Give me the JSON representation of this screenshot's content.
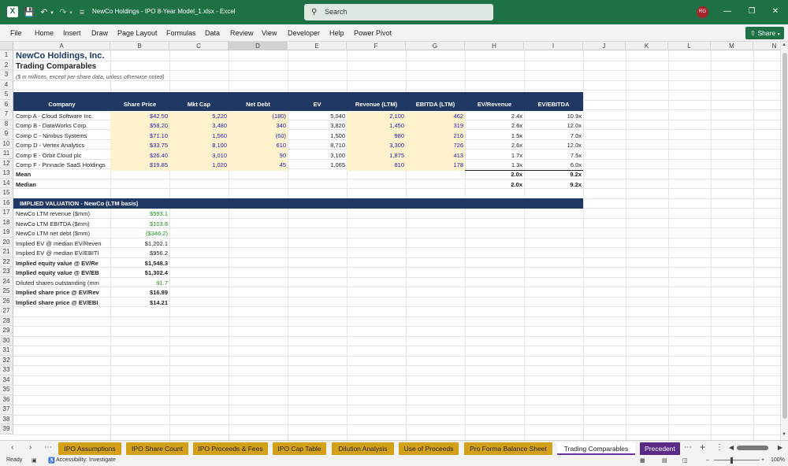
{
  "window": {
    "title": "NewCo Holdings - IPO 8-Year Model_1.xlsx  -  Excel",
    "search_placeholder": "Search",
    "user_initials": "RG",
    "accent": "#1e7145"
  },
  "menu": [
    "File",
    "Home",
    "Insert",
    "Draw",
    "Page Layout",
    "Formulas",
    "Data",
    "Review",
    "View",
    "Developer",
    "Help",
    "Power Pivot"
  ],
  "share_label": "Share",
  "columns": [
    "A",
    "B",
    "C",
    "D",
    "E",
    "F",
    "G",
    "H",
    "I",
    "J",
    "K",
    "L",
    "M",
    "N"
  ],
  "rows": [
    "1",
    "2",
    "3",
    "4",
    "5",
    "6",
    "7",
    "8",
    "9",
    "10",
    "11",
    "12",
    "13",
    "14",
    "15",
    "16",
    "17",
    "18",
    "19",
    "20",
    "21",
    "22",
    "23",
    "24",
    "25",
    "26",
    "27",
    "28",
    "29",
    "30",
    "31",
    "32",
    "33",
    "34",
    "35",
    "36",
    "37",
    "38",
    "39"
  ],
  "sheet": {
    "title": "NewCo Holdings, Inc.",
    "subtitle": "Trading Comparables",
    "note": "($ in millions, except per-share data, unless otherwise noted)",
    "headers": [
      "Company",
      "Share Price",
      "Mkt Cap",
      "Net Debt",
      "EV",
      "Revenue (LTM)",
      "EBITDA (LTM)",
      "EV/Revenue",
      "EV/EBITDA"
    ],
    "comps": [
      {
        "company": "Comp A - Cloud Software Inc.",
        "price": "$42.50",
        "mktcap": "5,220",
        "netdebt": "(180)",
        "ev": "5,040",
        "revenue": "2,100",
        "ebitda": "462",
        "ev_rev": "2.4x",
        "ev_ebitda": "10.9x"
      },
      {
        "company": "Comp B - DataWorks Corp.",
        "price": "$58.20",
        "mktcap": "3,480",
        "netdebt": "340",
        "ev": "3,820",
        "revenue": "1,450",
        "ebitda": "319",
        "ev_rev": "2.6x",
        "ev_ebitda": "12.0x"
      },
      {
        "company": "Comp C - Nimbus Systems",
        "price": "$71.10",
        "mktcap": "1,560",
        "netdebt": "(60)",
        "ev": "1,500",
        "revenue": "980",
        "ebitda": "216",
        "ev_rev": "1.5x",
        "ev_ebitda": "7.0x"
      },
      {
        "company": "Comp D - Vertex Analytics",
        "price": "$33.75",
        "mktcap": "8,100",
        "netdebt": "610",
        "ev": "8,710",
        "revenue": "3,300",
        "ebitda": "726",
        "ev_rev": "2.6x",
        "ev_ebitda": "12.0x"
      },
      {
        "company": "Comp E - Orbit Cloud plc",
        "price": "$26.40",
        "mktcap": "3,010",
        "netdebt": "90",
        "ev": "3,100",
        "revenue": "1,875",
        "ebitda": "413",
        "ev_rev": "1.7x",
        "ev_ebitda": "7.5x"
      },
      {
        "company": "Comp F - Pinnacle SaaS Holdings",
        "price": "$19.85",
        "mktcap": "1,020",
        "netdebt": "45",
        "ev": "1,065",
        "revenue": "810",
        "ebitda": "178",
        "ev_rev": "1.3x",
        "ev_ebitda": "6.0x"
      }
    ],
    "mean": {
      "label": "Mean",
      "ev_rev": "2.0x",
      "ev_ebitda": "9.2x"
    },
    "median": {
      "label": "Median",
      "ev_rev": "2.0x",
      "ev_ebitda": "9.2x"
    },
    "section_title": "IMPLIED VALUATION - NewCo (LTM basis)",
    "valuation": [
      {
        "label": "NewCo LTM revenue ($mm)",
        "value": "$593.1",
        "style": "green"
      },
      {
        "label": "NewCo LTM EBITDA ($mm)",
        "value": "$103.8",
        "style": "green"
      },
      {
        "label": "NewCo LTM net debt ($mm)",
        "value": "($346.2)",
        "style": "green"
      },
      {
        "label": "Implied EV @ median EV/Reven",
        "value": "$1,202.1",
        "style": "normal"
      },
      {
        "label": "Implied EV @ median EV/EBITI",
        "value": "$956.2",
        "style": "normal"
      },
      {
        "label": "Implied equity value @ EV/Re",
        "value": "$1,548.3",
        "style": "bold"
      },
      {
        "label": "Implied equity value @ EV/EB",
        "value": "$1,302.4",
        "style": "bold"
      },
      {
        "label": "Diluted shares outstanding (mm",
        "value": "91.7",
        "style": "green"
      },
      {
        "label": "Implied share price @ EV/Rev",
        "value": "$16.89",
        "style": "bold"
      },
      {
        "label": "Implied share price @ EV/EBI",
        "value": "$14.21",
        "style": "bold"
      }
    ]
  },
  "tabs": {
    "items": [
      "IPO Assumptions",
      "IPO Share Count",
      "IPO Proceeds & Fees",
      "IPO Cap Table",
      "Dilution Analysis",
      "Use of Proceeds",
      "Pro Forma Balance Sheet",
      "Trading Comparables",
      "Precedent"
    ],
    "active": "Trading Comparables",
    "tab_color": "#d4a017"
  },
  "status": {
    "ready": "Ready",
    "accessibility": "Accessibility: Investigate",
    "zoom": "100%"
  }
}
